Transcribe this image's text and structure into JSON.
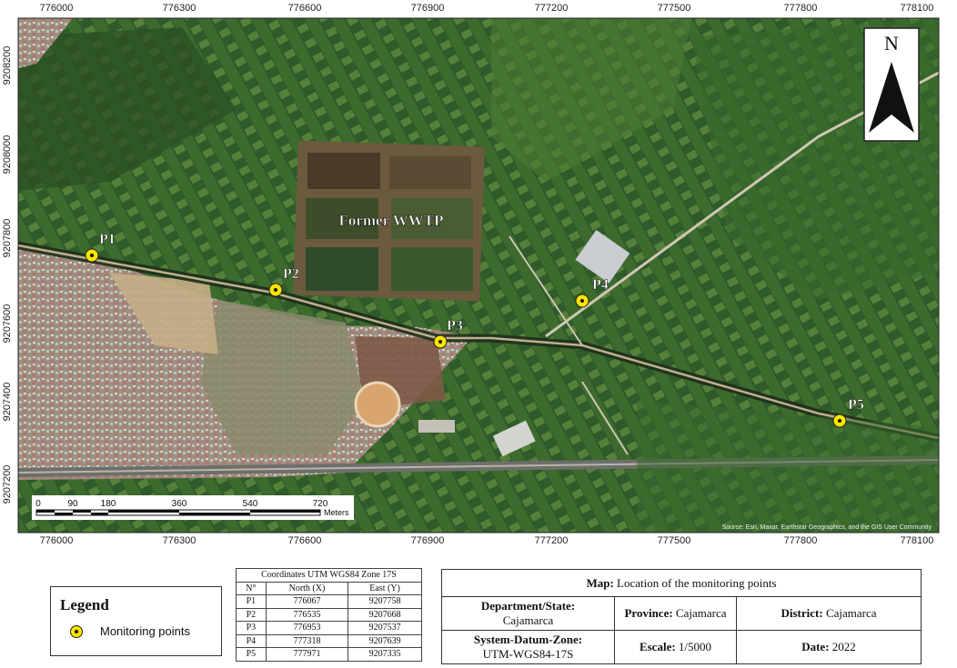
{
  "map": {
    "axis_top": [
      "776000",
      "776300",
      "776600",
      "776900",
      "777200",
      "777500",
      "777800",
      "778100"
    ],
    "axis_bottom": [
      "776000",
      "776300",
      "776600",
      "776900",
      "777200",
      "777500",
      "777800",
      "778100"
    ],
    "axis_left": [
      "9208200",
      "9208000",
      "9207800",
      "9207600",
      "9207400",
      "9207200"
    ],
    "features": {
      "wwtp_label": "Former WWTP"
    },
    "points": [
      {
        "label": "P1"
      },
      {
        "label": "P2"
      },
      {
        "label": "P3"
      },
      {
        "label": "P4"
      },
      {
        "label": "P5"
      }
    ],
    "scalebar": {
      "ticks": [
        "0",
        "90",
        "180",
        "360",
        "540",
        "720"
      ],
      "unit": "Meters"
    },
    "north_arrow_label": "N",
    "credits": "Source: Esri, Maxar, Earthstar Geographics, and the GIS User Community",
    "marker_color": "#ffe500"
  },
  "legend": {
    "title": "Legend",
    "item": "Monitoring points"
  },
  "coords_table": {
    "caption": "Coordinates UTM WGS84 Zone 17S",
    "headers": [
      "N°",
      "North (X)",
      "East (Y)"
    ],
    "rows": [
      [
        "P1",
        "776067",
        "9207758"
      ],
      [
        "P2",
        "776535",
        "9207668"
      ],
      [
        "P3",
        "776953",
        "9207537"
      ],
      [
        "P4",
        "777318",
        "9207639"
      ],
      [
        "P5",
        "777971",
        "9207335"
      ]
    ]
  },
  "info": {
    "map_label": "Map:",
    "map_value": "Location of the monitoring points",
    "department_label": "Department/State:",
    "department_value": "Cajamarca",
    "province_label": "Province:",
    "province_value": "Cajamarca",
    "district_label": "District:",
    "district_value": "Cajamarca",
    "datum_label": "System-Datum-Zone:",
    "datum_value": "UTM-WGS84-17S",
    "scale_label": "Escale:",
    "scale_value": "1/5000",
    "date_label": "Date:",
    "date_value": "2022"
  }
}
